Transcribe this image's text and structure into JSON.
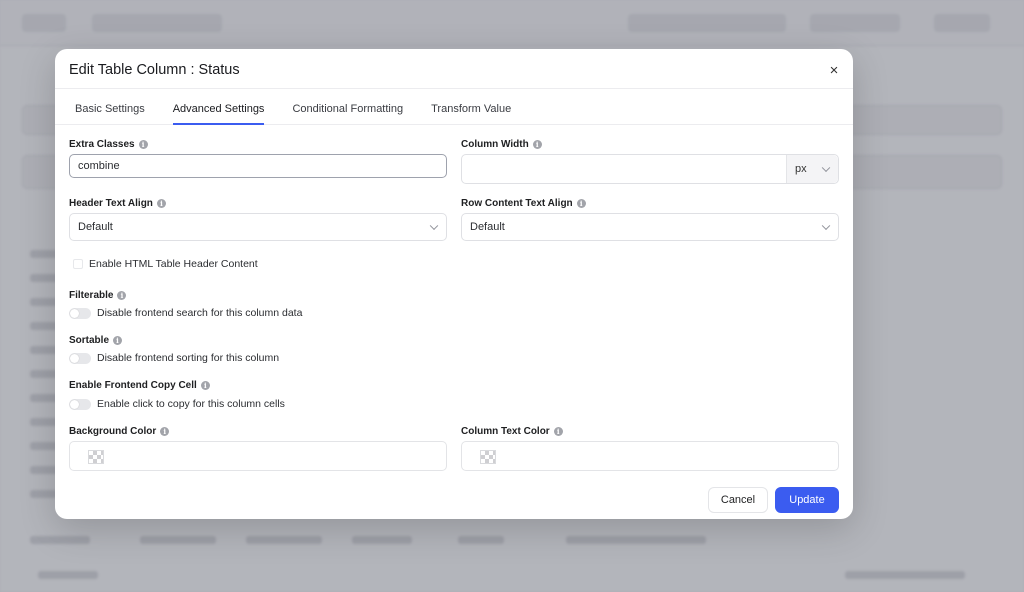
{
  "modal": {
    "title": "Edit Table Column : Status",
    "close_icon": "×"
  },
  "tabs": [
    {
      "label": "Basic Settings",
      "active": false
    },
    {
      "label": "Advanced Settings",
      "active": true
    },
    {
      "label": "Conditional Formatting",
      "active": false
    },
    {
      "label": "Transform Value",
      "active": false
    }
  ],
  "fields": {
    "extra_classes": {
      "label": "Extra Classes",
      "value": "combine"
    },
    "column_width": {
      "label": "Column Width",
      "value": "",
      "unit": "px"
    },
    "header_text_align": {
      "label": "Header Text Align",
      "value": "Default"
    },
    "row_content_text_align": {
      "label": "Row Content Text Align",
      "value": "Default"
    },
    "enable_html_header": {
      "label": "Enable HTML Table Header Content",
      "checked": false
    },
    "filterable": {
      "label": "Filterable",
      "toggle_label": "Disable frontend search for this column data",
      "on": false
    },
    "sortable": {
      "label": "Sortable",
      "toggle_label": "Disable frontend sorting for this column",
      "on": false
    },
    "copy_cell": {
      "label": "Enable Frontend Copy Cell",
      "toggle_label": "Enable click to copy for this column cells",
      "on": false
    },
    "background_color": {
      "label": "Background Color"
    },
    "column_text_color": {
      "label": "Column Text Color"
    }
  },
  "buttons": {
    "cancel": "Cancel",
    "update": "Update"
  },
  "colors": {
    "accent": "#3b5cf0"
  },
  "icons": {
    "info": "i"
  }
}
